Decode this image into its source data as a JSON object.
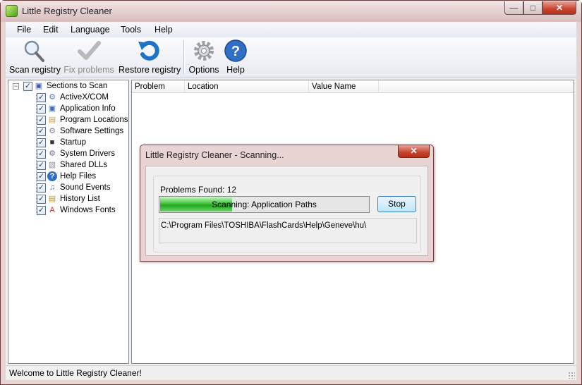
{
  "window": {
    "title": "Little Registry Cleaner",
    "controls": {
      "minimize": "—",
      "maximize": "□",
      "close": "✕"
    }
  },
  "menu": [
    "File",
    "Edit",
    "Language",
    "Tools",
    "Help"
  ],
  "toolbar": {
    "scan": "Scan registry",
    "fix": "Fix problems",
    "restore": "Restore registry",
    "options": "Options",
    "help": "Help"
  },
  "tree": {
    "root": "Sections to Scan",
    "items": [
      {
        "label": "ActiveX/COM",
        "icon": "activex-icon",
        "glyph": "⚙"
      },
      {
        "label": "Application Info",
        "icon": "application-icon",
        "glyph": "▣"
      },
      {
        "label": "Program Locations",
        "icon": "folder-icon",
        "glyph": "▤"
      },
      {
        "label": "Software Settings",
        "icon": "settings-icon",
        "glyph": "⚙"
      },
      {
        "label": "Startup",
        "icon": "monitor-icon",
        "glyph": "■"
      },
      {
        "label": "System Drivers",
        "icon": "driver-icon",
        "glyph": "⚙"
      },
      {
        "label": "Shared DLLs",
        "icon": "dll-icon",
        "glyph": "▧"
      },
      {
        "label": "Help Files",
        "icon": "help-icon",
        "glyph": "?"
      },
      {
        "label": "Sound Events",
        "icon": "sound-icon",
        "glyph": "♫"
      },
      {
        "label": "History List",
        "icon": "history-icon",
        "glyph": "▤"
      },
      {
        "label": "Windows Fonts",
        "icon": "font-icon",
        "glyph": "A"
      }
    ]
  },
  "list": {
    "columns": [
      "Problem",
      "Location",
      "Value Name"
    ]
  },
  "status": {
    "text": "Welcome to Little Registry Cleaner!"
  },
  "dialog": {
    "title": "Little Registry Cleaner - Scanning...",
    "close": "✕",
    "problems_found": "Problems Found:  12",
    "progress_value": 0.35,
    "progress_text": "Scanning: Application Paths",
    "stop": "Stop",
    "current_path": "C:\\Program Files\\TOSHIBA\\FlashCards\\Help\\Geneve\\hu\\"
  },
  "colors": {
    "frame": "#e9d4d4",
    "close_red": "#c8432d",
    "progress_green": "#22a81f",
    "help_blue": "#2f6fc7",
    "restore_blue": "#1e73c8"
  }
}
